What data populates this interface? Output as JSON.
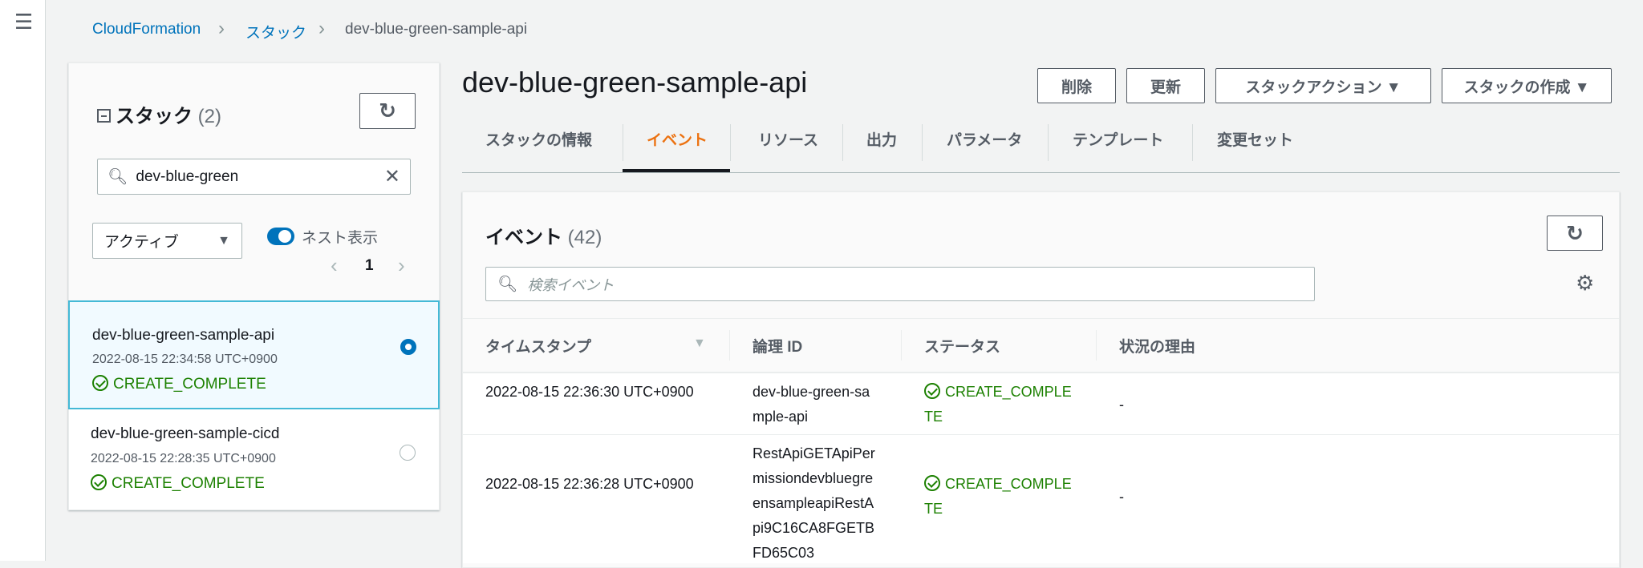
{
  "nav": {
    "menu_icon": "hamburger-icon"
  },
  "breadcrumb": [
    {
      "label": "CloudFormation"
    },
    {
      "label": "スタック"
    },
    {
      "label": "dev-blue-green-sample-api"
    }
  ],
  "sidebar": {
    "title": "スタック",
    "count": "(2)",
    "search_value": "dev-blue-green",
    "filter_selected": "アクティブ",
    "nested_toggle_label": "ネスト表示",
    "nested_toggle_on": true,
    "page": "1",
    "stacks": [
      {
        "name": "dev-blue-green-sample-api",
        "created": "2022-08-15 22:34:58 UTC+0900",
        "status": "CREATE_COMPLETE",
        "selected": true
      },
      {
        "name": "dev-blue-green-sample-cicd",
        "created": "2022-08-15 22:28:35 UTC+0900",
        "status": "CREATE_COMPLETE",
        "selected": false
      }
    ]
  },
  "main": {
    "title": "dev-blue-green-sample-api",
    "buttons": {
      "delete": "削除",
      "update": "更新",
      "stack_actions": "スタックアクション ▼",
      "create_stack": "スタックの作成 ▼"
    },
    "tabs": [
      {
        "label": "スタックの情報"
      },
      {
        "label": "イベント",
        "active": true
      },
      {
        "label": "リソース"
      },
      {
        "label": "出力"
      },
      {
        "label": "パラメータ"
      },
      {
        "label": "テンプレート"
      },
      {
        "label": "変更セット"
      }
    ],
    "events": {
      "title": "イベント",
      "count": "(42)",
      "search_placeholder": "検索イベント",
      "columns": [
        "タイムスタンプ",
        "論理 ID",
        "ステータス",
        "状況の理由"
      ],
      "rows": [
        {
          "timestamp": "2022-08-15 22:36:30 UTC+0900",
          "logical_id": "dev-blue-green-sample-api",
          "status": "CREATE_COMPLETE",
          "reason": "-"
        },
        {
          "timestamp": "2022-08-15 22:36:28 UTC+0900",
          "logical_id": "RestApiGETApiPermissiondevbluegreensampleapiRestApi9C16CA8FGETBFD65C03",
          "status": "CREATE_COMPLETE",
          "reason": "-"
        }
      ]
    }
  },
  "colors": {
    "link": "#0073bb",
    "accent": "#ec7211",
    "success": "#1d8102"
  }
}
